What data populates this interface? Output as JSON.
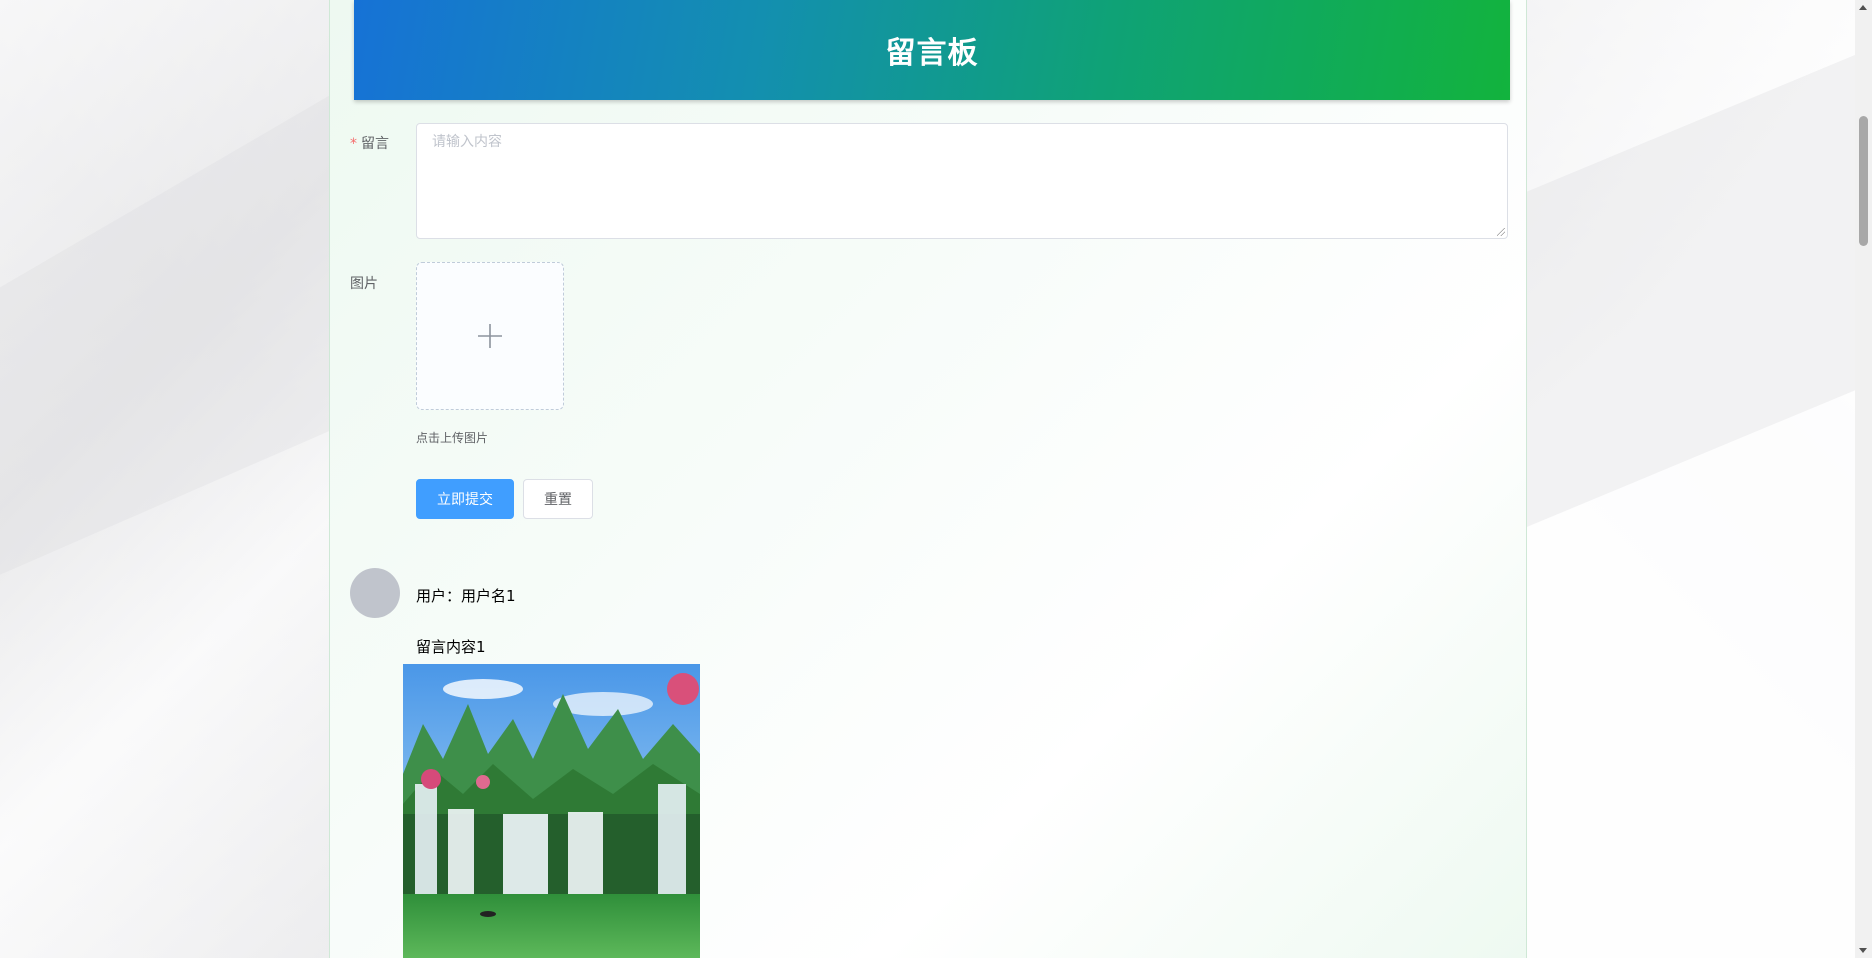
{
  "header": {
    "title": "留言板"
  },
  "form": {
    "message_label": "留言",
    "required_mark": "*",
    "message_placeholder": "请输入内容",
    "image_label": "图片",
    "upload_icon": "plus-icon",
    "upload_tip": "点击上传图片",
    "submit_label": "立即提交",
    "reset_label": "重置"
  },
  "comments": [
    {
      "user": "用户：用户名1",
      "content": "留言内容1"
    }
  ],
  "colors": {
    "primary": "#409eff",
    "required": "#f56c6c",
    "banner_start": "#1672d6",
    "banner_end": "#12b33d"
  }
}
